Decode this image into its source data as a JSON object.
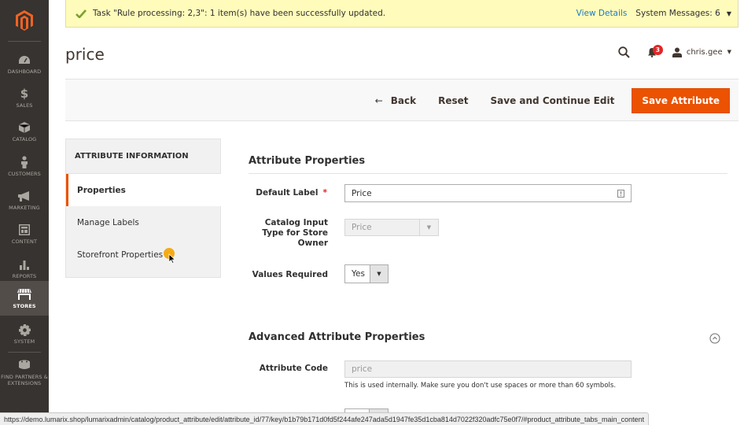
{
  "sidebar": {
    "logo": "magento-logo",
    "items": [
      {
        "label": "Dashboard",
        "icon": "dashboard-icon"
      },
      {
        "label": "Sales",
        "icon": "dollar-icon"
      },
      {
        "label": "Catalog",
        "icon": "box-icon"
      },
      {
        "label": "Customers",
        "icon": "person-icon"
      },
      {
        "label": "Marketing",
        "icon": "megaphone-icon"
      },
      {
        "label": "Content",
        "icon": "layout-icon"
      },
      {
        "label": "Reports",
        "icon": "bar-chart-icon"
      },
      {
        "label": "Stores",
        "icon": "storefront-icon",
        "active": true
      },
      {
        "label": "System",
        "icon": "gear-icon"
      },
      {
        "label": "Find Partners & Extensions",
        "icon": "extension-block-icon"
      }
    ]
  },
  "message_bar": {
    "text": "Task \"Rule processing: 2,3\": 1 item(s) have been successfully updated.",
    "view_details": "View Details",
    "system_messages": "System Messages: 6"
  },
  "header": {
    "title": "price",
    "notifications_count": "3",
    "username": "chris.gee"
  },
  "actions": {
    "back": "Back",
    "reset": "Reset",
    "save_continue": "Save and Continue Edit",
    "save": "Save Attribute"
  },
  "tabs": {
    "title": "ATTRIBUTE INFORMATION",
    "items": [
      {
        "label": "Properties",
        "active": true
      },
      {
        "label": "Manage Labels"
      },
      {
        "label": "Storefront Properties"
      }
    ]
  },
  "attribute_properties": {
    "title": "Attribute Properties",
    "default_label": {
      "label": "Default Label",
      "value": "Price",
      "required": "*"
    },
    "input_type": {
      "label": "Catalog Input Type for Store Owner",
      "value": "Price"
    },
    "values_required": {
      "label": "Values Required",
      "value": "Yes"
    }
  },
  "advanced_properties": {
    "title": "Advanced Attribute Properties",
    "attribute_code": {
      "label": "Attribute Code",
      "value": "price",
      "note": "This is used internally. Make sure you don't use spaces or more than 60 symbols."
    }
  },
  "status_url": "https://demo.lumarix.shop/lumarixadmin/catalog/product_attribute/edit/attribute_id/77/key/b1b79b171d0fd5f244afe247ada5d1947fe35d1cba814d7022f320adfc75e0f7/#product_attribute_tabs_main_content",
  "colors": {
    "accent": "#eb5202",
    "sidebar_bg": "#373330",
    "message_bg": "#fffbbb",
    "link": "#1979c3"
  }
}
